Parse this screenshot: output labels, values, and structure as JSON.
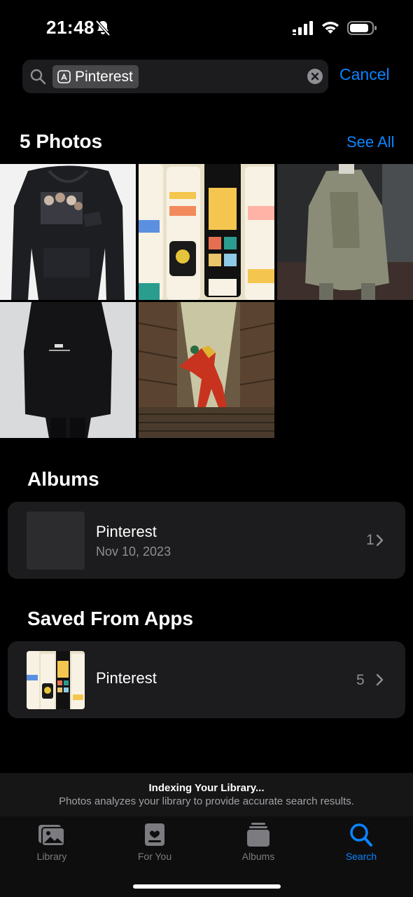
{
  "status_bar": {
    "time": "21:48"
  },
  "search": {
    "token": "Pinterest",
    "cancel_label": "Cancel"
  },
  "photos_section": {
    "title": "5 Photos",
    "see_all_label": "See All"
  },
  "albums_section": {
    "title": "Albums",
    "items": [
      {
        "name": "Pinterest",
        "date": "Nov 10, 2023",
        "count": "1"
      }
    ]
  },
  "saved_section": {
    "title": "Saved From Apps",
    "items": [
      {
        "name": "Pinterest",
        "count": "5"
      }
    ]
  },
  "indexing": {
    "title": "Indexing Your Library...",
    "subtitle": "Photos analyzes your library to provide accurate search results."
  },
  "tab_bar": {
    "tabs": [
      {
        "label": "Library",
        "icon": "photos-icon"
      },
      {
        "label": "For You",
        "icon": "for-you-icon"
      },
      {
        "label": "Albums",
        "icon": "albums-icon"
      },
      {
        "label": "Search",
        "icon": "search-icon"
      }
    ],
    "active": "Search"
  },
  "colors": {
    "accent": "#0a84ff",
    "card": "#1c1c1e",
    "background": "#000000"
  }
}
